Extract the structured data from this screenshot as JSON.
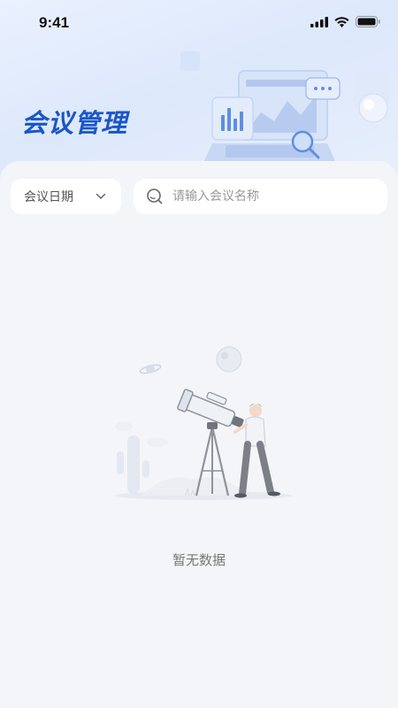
{
  "status_bar": {
    "time": "9:41",
    "icons": [
      "signal-icon",
      "wifi-icon",
      "battery-icon"
    ]
  },
  "header": {
    "title": "会议管理"
  },
  "filters": {
    "date_label": "会议日期",
    "search_placeholder": "请输入会议名称",
    "search_value": ""
  },
  "empty_state": {
    "text": "暂无数据"
  },
  "colors": {
    "title": "#1a56c8",
    "background": "#f4f5f8",
    "header_gradient": "#dde8fb"
  }
}
